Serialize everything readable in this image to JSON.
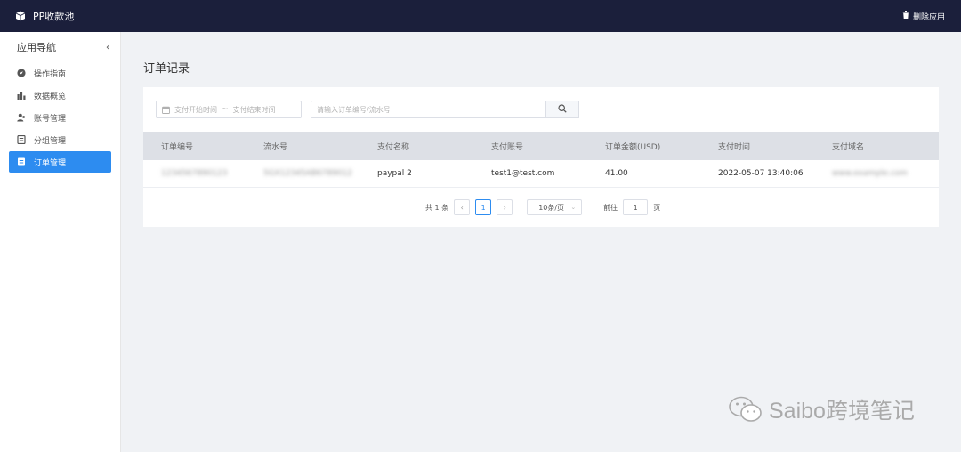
{
  "header": {
    "app_name": "PP收款池",
    "delete_app_label": "删除应用"
  },
  "sidebar": {
    "title": "应用导航",
    "collapse_glyph": "‹",
    "items": [
      {
        "label": "操作指南",
        "icon": "compass-icon"
      },
      {
        "label": "数据概览",
        "icon": "bar-chart-icon"
      },
      {
        "label": "账号管理",
        "icon": "users-icon"
      },
      {
        "label": "分组管理",
        "icon": "list-icon"
      },
      {
        "label": "订单管理",
        "icon": "order-icon",
        "active": true
      }
    ]
  },
  "main": {
    "title": "订单记录",
    "filters": {
      "start_placeholder": "支付开始时间",
      "separator": "~",
      "end_placeholder": "支付结束时间",
      "search_placeholder": "请输入订单编号/流水号"
    },
    "table": {
      "columns": [
        "订单编号",
        "流水号",
        "支付名称",
        "支付账号",
        "订单金额(USD)",
        "支付时间",
        "支付域名"
      ],
      "rows": [
        {
          "order_no": "1234567890123",
          "serial_no": "5GX12345AB6789012",
          "pay_name": "paypal 2",
          "pay_account": "test1@test.com",
          "amount": "41.00",
          "pay_time": "2022-05-07 13:40:06",
          "domain": "www.example.com"
        }
      ]
    },
    "pagination": {
      "total_text": "共 1 条",
      "prev": "‹",
      "current_page": "1",
      "next": "›",
      "page_size": "10条/页",
      "page_size_arrow": "⌄",
      "goto_label": "前往",
      "goto_value": "1",
      "page_suffix": "页"
    }
  },
  "watermark": {
    "text": "Saibo跨境笔记"
  },
  "colors": {
    "topbar": "#1b1f3b",
    "accent": "#2d8cf0",
    "background": "#f0f2f5",
    "table_header": "#dde0e6"
  }
}
